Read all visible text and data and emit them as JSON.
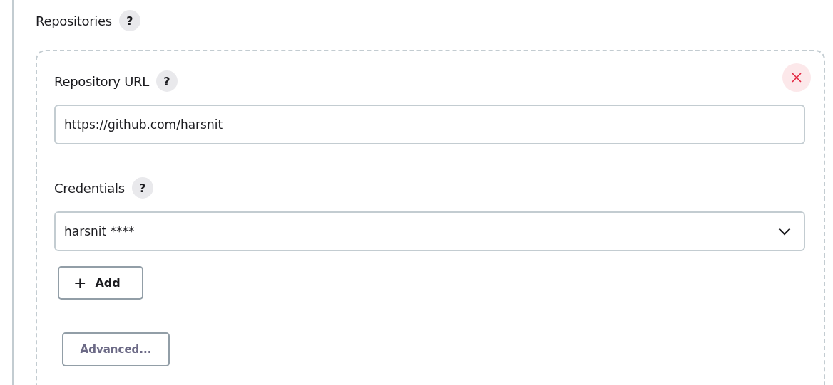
{
  "section": {
    "title": "Repositories",
    "help": "?"
  },
  "repository": {
    "url_label": "Repository URL",
    "url_help": "?",
    "url_value": "https://github.com/harsnit",
    "credentials_label": "Credentials",
    "credentials_help": "?",
    "credentials_value": "harsnit ****",
    "add_button": {
      "icon": "+",
      "label": "Add"
    },
    "advanced_button": "Advanced..."
  }
}
